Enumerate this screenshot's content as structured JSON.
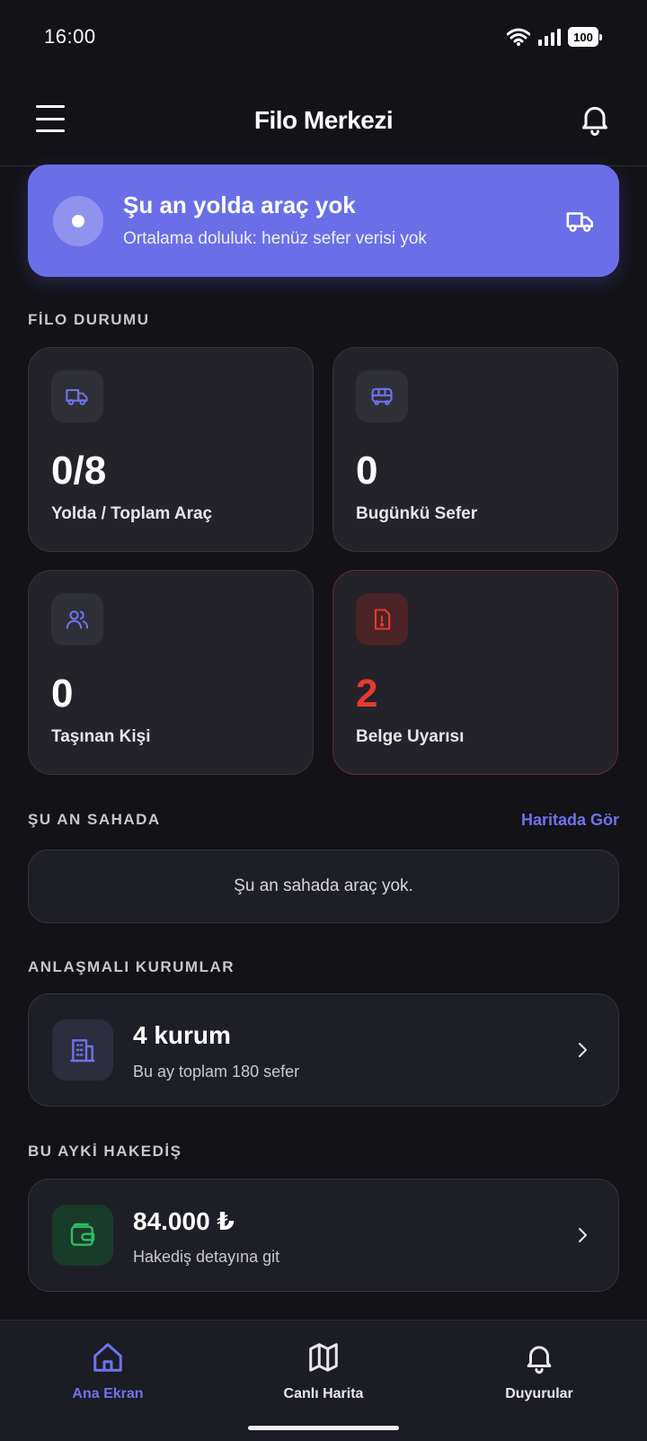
{
  "status_bar": {
    "time": "16:00",
    "battery": "100"
  },
  "header": {
    "title": "Filo Merkezi"
  },
  "banner": {
    "title": "Şu an yolda araç yok",
    "subtitle": "Ortalama doluluk: henüz sefer verisi yok"
  },
  "fleet": {
    "section_title": "FİLO DURUMU",
    "cards": [
      {
        "value": "0/8",
        "label": "Yolda / Toplam Araç",
        "icon": "truck-icon"
      },
      {
        "value": "0",
        "label": "Bugünkü Sefer",
        "icon": "bus-icon"
      },
      {
        "value": "0",
        "label": "Taşınan Kişi",
        "icon": "users-icon"
      },
      {
        "value": "2",
        "label": "Belge Uyarısı",
        "icon": "document-alert-icon"
      }
    ]
  },
  "field": {
    "section_title": "ŞU AN SAHADA",
    "link": "Haritada Gör",
    "empty_text": "Şu an sahada araç yok."
  },
  "institutions": {
    "section_title": "ANLAŞMALI KURUMLAR",
    "title": "4 kurum",
    "subtitle": "Bu ay toplam 180 sefer"
  },
  "earnings": {
    "section_title": "BU AYKİ HAKEDİŞ",
    "title": "84.000 ₺",
    "subtitle": "Hakediş detayına git"
  },
  "bottom_nav": {
    "items": [
      {
        "label": "Ana Ekran",
        "icon": "home-icon",
        "active": true
      },
      {
        "label": "Canlı Harita",
        "icon": "map-icon",
        "active": false
      },
      {
        "label": "Duyurular",
        "icon": "bell-icon",
        "active": false
      }
    ]
  },
  "colors": {
    "accent": "#6a6fe8",
    "alert": "#e53b2f",
    "success": "#2fbf62",
    "background": "#121217"
  }
}
